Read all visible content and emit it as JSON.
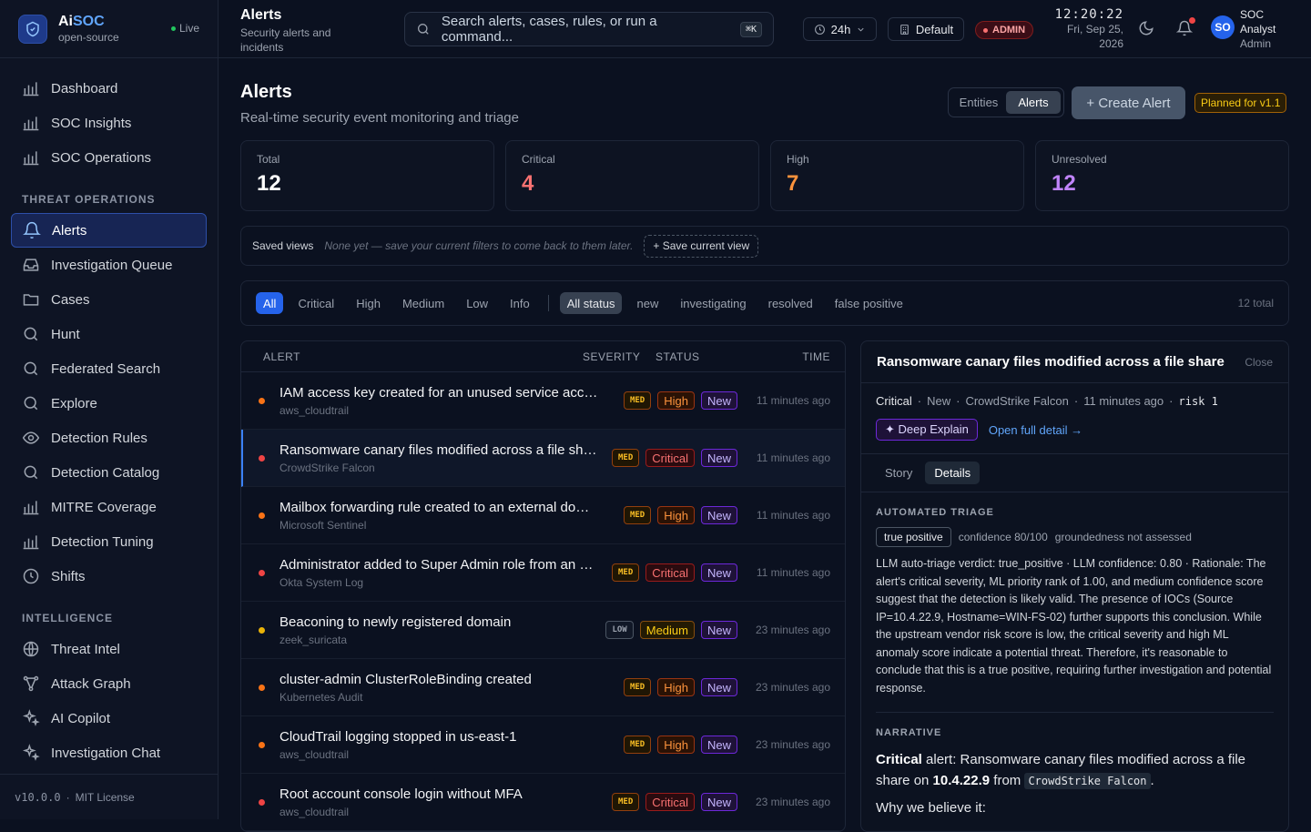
{
  "brand": {
    "name_a": "Ai",
    "name_b": "SOC",
    "sub": "open-source",
    "live": "Live"
  },
  "nav": {
    "main": [
      {
        "label": "Dashboard",
        "icon": "bar-chart-icon"
      },
      {
        "label": "SOC Insights",
        "icon": "bar-chart-icon"
      },
      {
        "label": "SOC Operations",
        "icon": "bar-chart-icon"
      }
    ],
    "section_threat": "THREAT OPERATIONS",
    "threat": [
      {
        "label": "Alerts",
        "icon": "bell-icon"
      },
      {
        "label": "Investigation Queue",
        "icon": "inbox-icon"
      },
      {
        "label": "Cases",
        "icon": "folder-icon"
      },
      {
        "label": "Hunt",
        "icon": "search-icon"
      },
      {
        "label": "Federated Search",
        "icon": "search-icon"
      },
      {
        "label": "Explore",
        "icon": "search-icon"
      },
      {
        "label": "Detection Rules",
        "icon": "eye-icon"
      },
      {
        "label": "Detection Catalog",
        "icon": "search-icon"
      },
      {
        "label": "MITRE Coverage",
        "icon": "bar-chart-icon"
      },
      {
        "label": "Detection Tuning",
        "icon": "bar-chart-icon"
      },
      {
        "label": "Shifts",
        "icon": "clock-icon"
      }
    ],
    "section_intel": "INTELLIGENCE",
    "intel": [
      {
        "label": "Threat Intel",
        "icon": "globe-icon"
      },
      {
        "label": "Attack Graph",
        "icon": "graph-icon"
      },
      {
        "label": "AI Copilot",
        "icon": "sparkles-icon"
      },
      {
        "label": "Investigation Chat",
        "icon": "sparkles-icon"
      }
    ],
    "version": "v10.0.0",
    "license": "MIT License"
  },
  "topbar": {
    "title": "Alerts",
    "subtitle": "Security alerts and incidents",
    "search_placeholder": "Search alerts, cases, rules, or run a command...",
    "search_kbd": "⌘K",
    "range": "24h",
    "tenant": "Default",
    "role_badge": "ADMIN",
    "time": "12:20:22",
    "date": "Fri, Sep 25, 2026",
    "user_initials": "SO",
    "user_name_1": "SOC",
    "user_name_2": "Analyst",
    "user_role": "Admin"
  },
  "page": {
    "title": "Alerts",
    "subtitle": "Real-time security event monitoring and triage",
    "toggle": [
      "Entities",
      "Alerts"
    ],
    "create_button": "+ Create Alert",
    "planned_badge": "Planned for v1.1"
  },
  "stats": [
    {
      "label": "Total",
      "value": "12",
      "color": "#ffffff"
    },
    {
      "label": "Critical",
      "value": "4",
      "color": "#f87171"
    },
    {
      "label": "High",
      "value": "7",
      "color": "#fb923c"
    },
    {
      "label": "Unresolved",
      "value": "12",
      "color": "#c084fc"
    }
  ],
  "saved_views": {
    "label": "Saved views",
    "hint": "None yet — save your current filters to come back to them later.",
    "button": "+ Save current view"
  },
  "filters": {
    "severity": [
      "All",
      "Critical",
      "High",
      "Medium",
      "Low",
      "Info"
    ],
    "status": [
      "All status",
      "new",
      "investigating",
      "resolved",
      "false positive"
    ],
    "total": "12 total"
  },
  "alerts_table": {
    "columns": {
      "alert": "ALERT",
      "severity": "SEVERITY",
      "status": "STATUS",
      "time": "TIME"
    },
    "rows": [
      {
        "title": "IAM access key created for an unused service account",
        "source": "aws_cloudtrail",
        "conf": "MED",
        "severity": "High",
        "status": "New",
        "time": "11 minutes ago",
        "dot": "#f97316"
      },
      {
        "title": "Ransomware canary files modified across a file share",
        "source": "CrowdStrike Falcon",
        "conf": "MED",
        "severity": "Critical",
        "status": "New",
        "time": "11 minutes ago",
        "dot": "#ef4444"
      },
      {
        "title": "Mailbox forwarding rule created to an external domain",
        "source": "Microsoft Sentinel",
        "conf": "MED",
        "severity": "High",
        "status": "New",
        "time": "11 minutes ago",
        "dot": "#f97316"
      },
      {
        "title": "Administrator added to Super Admin role from an unfamiliar location",
        "source": "Okta System Log",
        "conf": "MED",
        "severity": "Critical",
        "status": "New",
        "time": "11 minutes ago",
        "dot": "#ef4444"
      },
      {
        "title": "Beaconing to newly registered domain",
        "source": "zeek_suricata",
        "conf": "LOW",
        "severity": "Medium",
        "status": "New",
        "time": "23 minutes ago",
        "dot": "#eab308"
      },
      {
        "title": "cluster-admin ClusterRoleBinding created",
        "source": "Kubernetes Audit",
        "conf": "MED",
        "severity": "High",
        "status": "New",
        "time": "23 minutes ago",
        "dot": "#f97316"
      },
      {
        "title": "CloudTrail logging stopped in us-east-1",
        "source": "aws_cloudtrail",
        "conf": "MED",
        "severity": "High",
        "status": "New",
        "time": "23 minutes ago",
        "dot": "#f97316"
      },
      {
        "title": "Root account console login without MFA",
        "source": "aws_cloudtrail",
        "conf": "MED",
        "severity": "Critical",
        "status": "New",
        "time": "23 minutes ago",
        "dot": "#ef4444"
      }
    ]
  },
  "detail": {
    "title": "Ransomware canary files modified across a file share",
    "close": "Close",
    "severity": "Critical",
    "status": "New",
    "source": "CrowdStrike Falcon",
    "time": "11 minutes ago",
    "risk": "risk 1",
    "deep_explain": "✦ Deep Explain",
    "open_full": "Open full detail →",
    "tabs": [
      "Story",
      "Details"
    ],
    "triage_heading": "AUTOMATED TRIAGE",
    "verdict": "true positive",
    "confidence": "confidence 80/100",
    "groundedness": "groundedness not assessed",
    "rationale": "LLM auto-triage verdict: true_positive · LLM confidence: 0.80 · Rationale: The alert's critical severity, ML priority rank of 1.00, and medium confidence score suggest that the detection is likely valid. The presence of IOCs (Source IP=10.4.22.9, Hostname=WIN-FS-02) further supports this conclusion. While the upstream vendor risk score is low, the critical severity and high ML anomaly score indicate a potential threat. Therefore, it's reasonable to conclude that this is a true positive, requiring further investigation and potential response.",
    "narrative_heading": "NARRATIVE",
    "narrative_sev": "Critical",
    "narrative_a": " alert: Ransomware canary files modified across a file share on ",
    "narrative_ip": "10.4.22.9",
    "narrative_b": " from ",
    "narrative_src": "CrowdStrike Falcon",
    "narrative_c": ".",
    "why": "Why we believe it:"
  }
}
